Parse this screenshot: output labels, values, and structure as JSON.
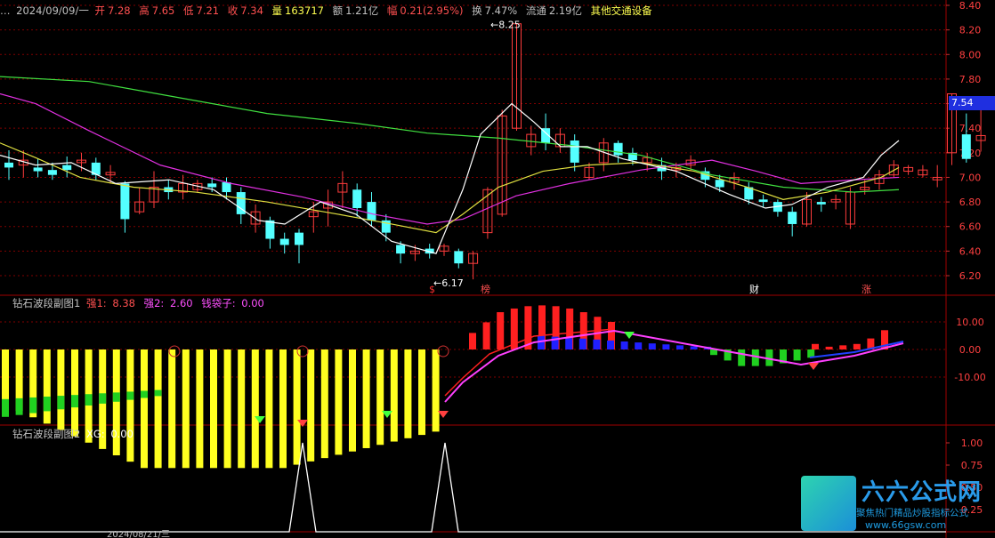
{
  "main": {
    "title_left": "…",
    "date": "2024/09/09/一",
    "open_label": "开",
    "open": "7.28",
    "high_label": "高",
    "high": "7.65",
    "low_label": "低",
    "low": "7.21",
    "close_label": "收",
    "close": "7.34",
    "vol_label": "量",
    "vol": "163717",
    "amt_label": "额",
    "amt": "1.21亿",
    "chg_label": "幅",
    "chg": "0.21(2.95%)",
    "turn_label": "换",
    "turn": "7.47%",
    "float_label": "流通",
    "float": "2.19亿",
    "industry": "其他交通设备",
    "high_marker": "8.25",
    "low_marker": "6.17",
    "current_price": "7.54",
    "markers": [
      "$",
      "榜",
      "财",
      "涨"
    ],
    "y_ticks": [
      "8.40",
      "8.20",
      "8.00",
      "7.80",
      "7.60",
      "7.40",
      "7.20",
      "7.00",
      "6.80",
      "6.60",
      "6.40",
      "6.20"
    ]
  },
  "sub1": {
    "name": "钻石波段副图1",
    "s1_label": "强1:",
    "s1": "8.38",
    "s2_label": "强2:",
    "s2": "2.60",
    "s3_label": "钱袋子:",
    "s3": "0.00",
    "y_ticks": [
      "10.00",
      "0.00",
      "-10.00"
    ]
  },
  "sub2": {
    "name": "钻石波段副图2",
    "xg_label": "XG:",
    "xg": "0.00",
    "y_ticks": [
      "1.00",
      "0.75",
      "0.50",
      "0.25"
    ]
  },
  "bottom": {
    "date_label": "2024/08/21/三"
  },
  "watermark": {
    "title": "六六公式网",
    "sub": "聚焦热门精品炒股指标公式",
    "url": "www.66gsw.com"
  },
  "colors": {
    "up": "#ff3c3c",
    "down": "#54ffff",
    "bg": "#000000",
    "grid": "#800000"
  }
}
